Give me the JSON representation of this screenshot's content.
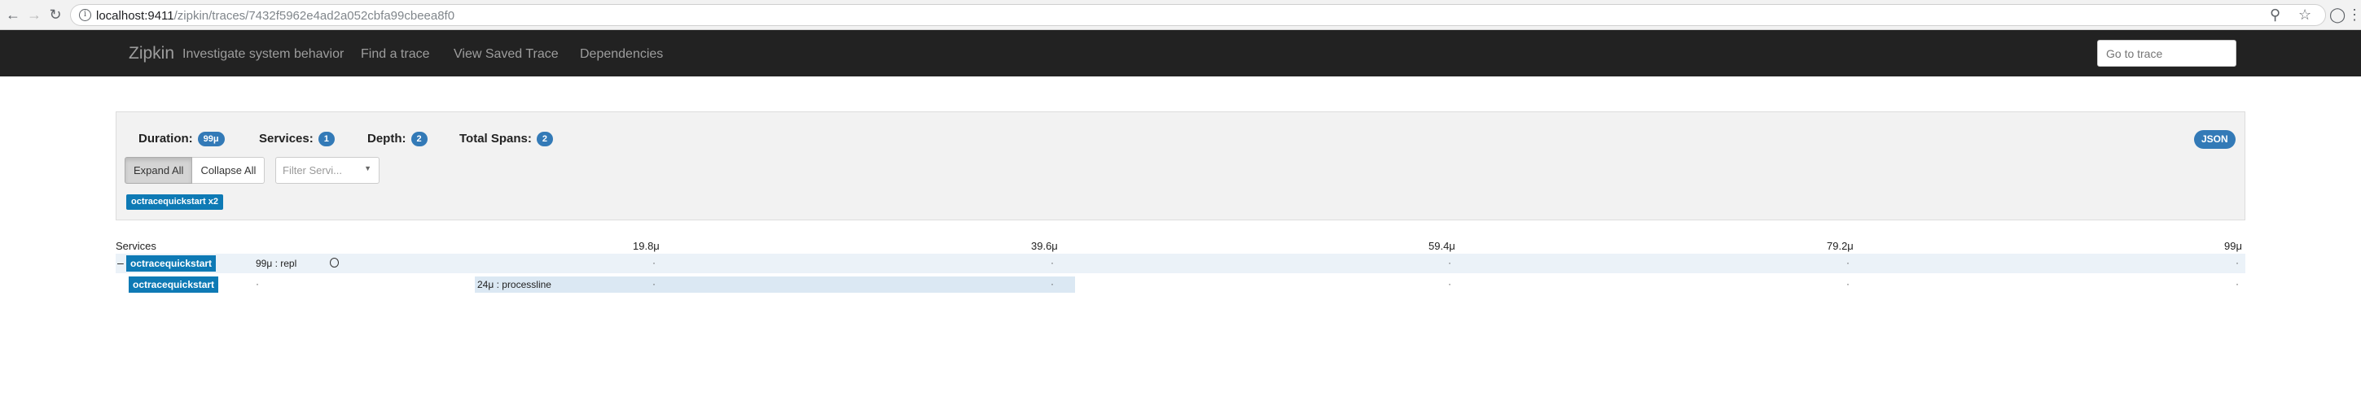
{
  "browser": {
    "url_host": "localhost:9411",
    "url_path": "/zipkin/traces/7432f5962e4ad2a052cbfa99cbeea8f0",
    "back_icon": "arrow-left-icon",
    "forward_icon": "arrow-right-icon",
    "reload_icon": "reload-icon"
  },
  "navbar": {
    "brand": "Zipkin",
    "tagline": "Investigate system behavior",
    "links": [
      "Find a trace",
      "View Saved Trace",
      "Dependencies"
    ],
    "goto_placeholder": "Go to trace"
  },
  "summary": {
    "duration_label": "Duration:",
    "duration_value": "99μ",
    "services_label": "Services:",
    "services_value": "1",
    "depth_label": "Depth:",
    "depth_value": "2",
    "total_spans_label": "Total Spans:",
    "total_spans_value": "2",
    "json_label": "JSON",
    "expand_all": "Expand All",
    "collapse_all": "Collapse All",
    "filter_placeholder": "Filter Servi...",
    "service_tag": "octracequickstart x2"
  },
  "timeline": {
    "services_header": "Services",
    "ticks": [
      "19.8μ",
      "39.6μ",
      "59.4μ",
      "79.2μ",
      "99μ"
    ],
    "spans": [
      {
        "toggle": "–",
        "service": "octracequickstart",
        "label": "99μ : repl",
        "start_fraction": 0.0,
        "duration_fraction": 1.0
      },
      {
        "toggle": "",
        "service": "octracequickstart",
        "label": "24μ : processline",
        "start_fraction": 0.27,
        "duration_fraction": 0.24
      }
    ]
  },
  "colors": {
    "navbar_bg": "#222222",
    "badge_blue": "#337ab7",
    "service_blue": "#0e7ab5",
    "panel_bg": "#f2f2f2",
    "span_bar": "#dbe8f3"
  }
}
